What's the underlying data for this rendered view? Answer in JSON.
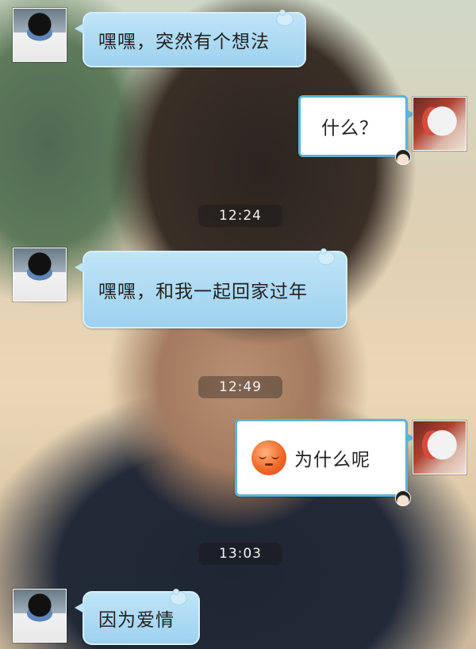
{
  "messages": [
    {
      "side": "friend",
      "text": "嘿嘿，突然有个想法"
    },
    {
      "side": "me",
      "text": "什么？"
    },
    {
      "side": "friend",
      "text": "嘿嘿，和我一起回家过年"
    },
    {
      "side": "me",
      "text": "为什么呢",
      "emoji": "sleepy-face-emoji"
    },
    {
      "side": "friend",
      "text": "因为爱情"
    }
  ],
  "timestamps": [
    "12:24",
    "12:49",
    "13:03"
  ],
  "colors": {
    "incoming_bubble": "#9ed1ee",
    "outgoing_bubble_border": "#5fb2d6",
    "outgoing_bubble_fill": "#ffffff"
  }
}
